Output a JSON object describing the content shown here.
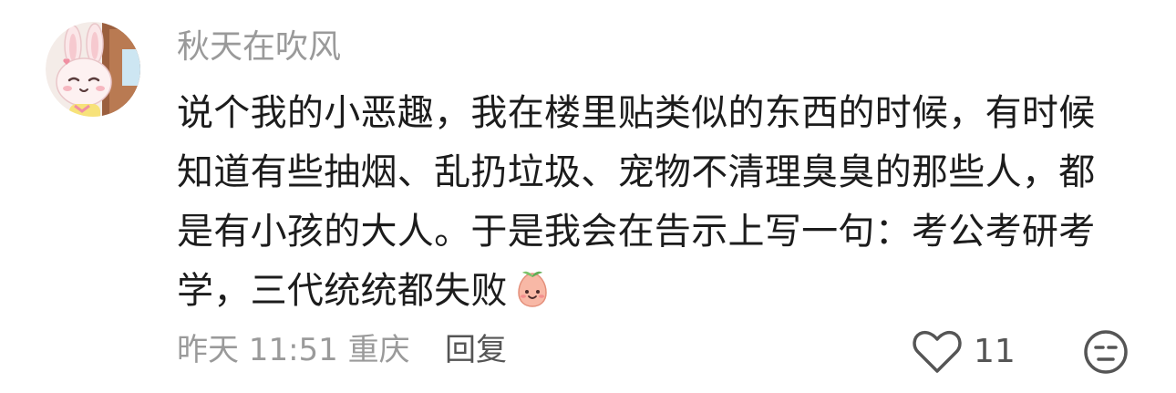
{
  "comment": {
    "author": "秋天在吹风",
    "body_lines": [
      "说个我的小恶趣，我在楼里贴类似的东西的时候，有时候",
      "知道有些抽烟、乱扔垃圾、宠物不清理臭臭的那些人，都",
      "是有小孩的大人。于是我会在告示上写一句：考公考研考",
      "学，三代统统都失败"
    ],
    "emoji": "peach-smile-emoji",
    "meta": "昨天 11:51 重庆",
    "reply_label": "回复",
    "like_count": "11",
    "avatar": "cartoon-bunny-avatar",
    "icons": {
      "like": "heart-outline-icon",
      "dislike": "unamused-face-icon"
    },
    "colors": {
      "text": "#1c1c1c",
      "muted": "#9a9a9a",
      "action": "#555555"
    }
  }
}
